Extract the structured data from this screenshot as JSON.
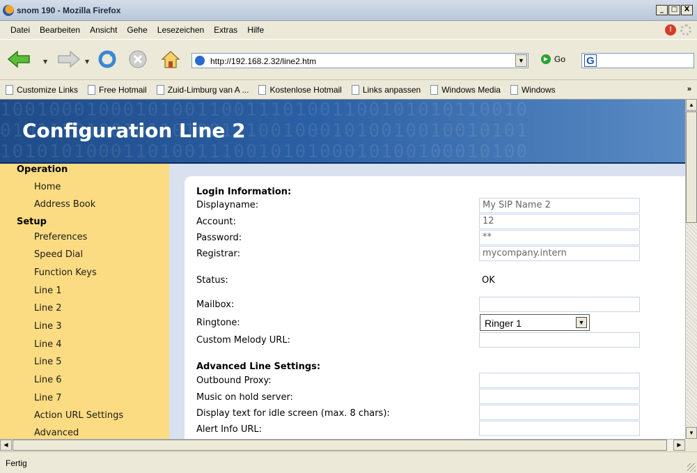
{
  "window": {
    "title": "snom 190 - Mozilla Firefox",
    "min": "_",
    "max": "□",
    "close": "X"
  },
  "menu": [
    "Datei",
    "Bearbeiten",
    "Ansicht",
    "Gehe",
    "Lesezeichen",
    "Extras",
    "Hilfe"
  ],
  "nav": {
    "url": "http://192.168.2.32/line2.htm",
    "go_label": "Go",
    "search_logo": "G"
  },
  "bookmarks": [
    "Customize Links",
    "Free Hotmail",
    "Zuid-Limburg van A ...",
    "Kostenlose Hotmail",
    "Links anpassen",
    "Windows Media",
    "Windows"
  ],
  "bookmarks_more": "»",
  "page": {
    "banner_title": "Configuration Line 2",
    "banner_bits": [
      "1001000100010100110011101001100101010110010",
      "0101110100101101001110010001010010010010101",
      "1010101000110100111001010100010100100010100"
    ],
    "sidebar": {
      "operation_head": "Operation",
      "operation_items": [
        "Home",
        "Address Book"
      ],
      "setup_head": "Setup",
      "setup_items": [
        "Preferences",
        "Speed Dial",
        "Function Keys",
        "Line 1",
        "Line 2",
        "Line 3",
        "Line 4",
        "Line 5",
        "Line 6",
        "Line 7",
        "Action URL Settings",
        "Advanced"
      ]
    },
    "login_head": "Login Information:",
    "fields": {
      "displayname": {
        "label": "Displayname:",
        "value": "My SIP Name 2"
      },
      "account": {
        "label": "Account:",
        "value": "12"
      },
      "password": {
        "label": "Password:",
        "value": "**"
      },
      "registrar": {
        "label": "Registrar:",
        "value": "mycompany.intern"
      },
      "status": {
        "label": "Status:",
        "value": "OK"
      },
      "mailbox": {
        "label": "Mailbox:",
        "value": ""
      },
      "ringtone": {
        "label": "Ringtone:",
        "value": "Ringer 1"
      },
      "custom_melody": {
        "label": "Custom Melody URL:",
        "value": ""
      }
    },
    "advanced_head": "Advanced Line Settings:",
    "advanced": {
      "outbound_proxy": {
        "label": "Outbound Proxy:",
        "value": ""
      },
      "music_on_hold": {
        "label": "Music on hold server:",
        "value": ""
      },
      "idle_text": {
        "label": "Display text for idle screen (max. 8 chars):",
        "value": ""
      },
      "alert_info": {
        "label": "Alert Info URL:",
        "value": ""
      }
    }
  },
  "status_text": "Fertig"
}
